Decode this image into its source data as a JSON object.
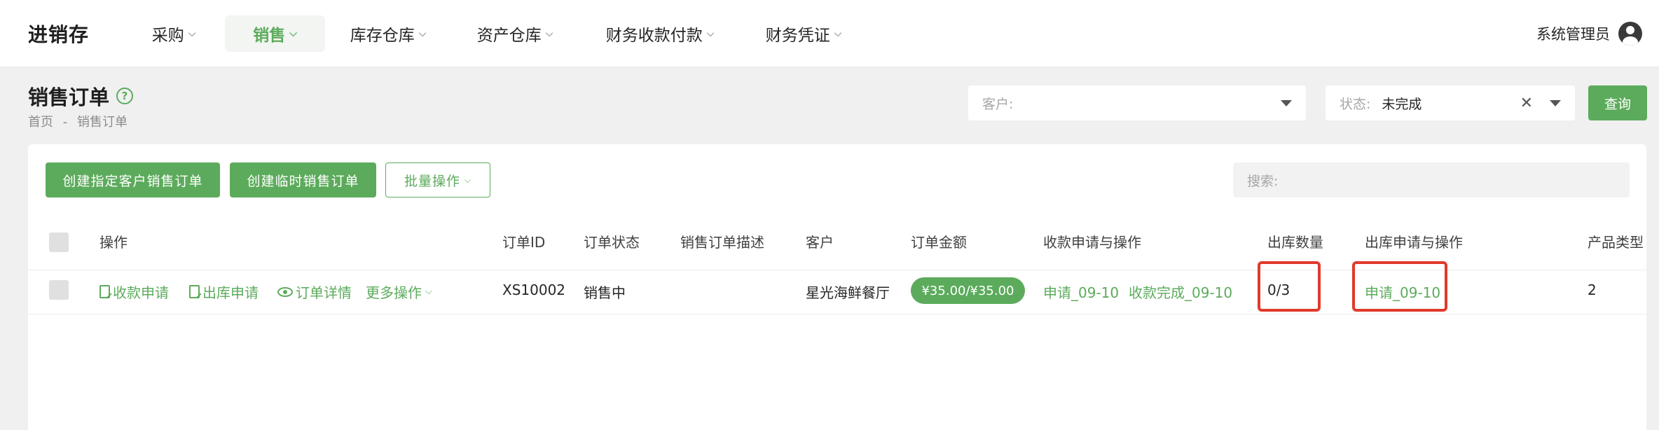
{
  "app": {
    "title": "进销存"
  },
  "nav": [
    {
      "label": "采购",
      "active": false
    },
    {
      "label": "销售",
      "active": true
    },
    {
      "label": "库存仓库",
      "active": false
    },
    {
      "label": "资产仓库",
      "active": false
    },
    {
      "label": "财务收款付款",
      "active": false
    },
    {
      "label": "财务凭证",
      "active": false
    }
  ],
  "user": {
    "name": "系统管理员",
    "icon": "user-avatar-icon"
  },
  "page": {
    "title": "销售订单",
    "help_icon": "?",
    "breadcrumb": [
      "首页",
      "-",
      "销售订单"
    ]
  },
  "filters": {
    "customer": {
      "label": "客户:",
      "value": ""
    },
    "status": {
      "label": "状态:",
      "value": "未完成",
      "clear": "✕"
    },
    "query_label": "查询"
  },
  "toolbar": {
    "create_customer_order": "创建指定客户销售订单",
    "create_temp_order": "创建临时销售订单",
    "batch_ops": "批量操作",
    "search_placeholder": "搜索:"
  },
  "table": {
    "headers": {
      "ops": "操作",
      "order_id": "订单ID",
      "order_status": "订单状态",
      "description": "销售订单描述",
      "customer": "客户",
      "amount": "订单金额",
      "payment": "收款申请与操作",
      "out_qty": "出库数量",
      "out_apply": "出库申请与操作",
      "product_type": "产品类型"
    },
    "rows": [
      {
        "ops": {
          "payment_apply": "收款申请",
          "out_apply": "出库申请",
          "details": "订单详情",
          "more": "更多操作"
        },
        "order_id": "XS10002",
        "order_status": "销售中",
        "description": "",
        "customer": "星光海鲜餐厅",
        "amount": "¥35.00/¥35.00",
        "payment_apply_link": "申请_09-10",
        "payment_done_link": "收款完成_09-10",
        "out_qty": "0/3",
        "out_apply_link": "申请_09-10",
        "product_type": "2"
      }
    ]
  },
  "colors": {
    "accent": "#5cab5c",
    "highlight": "#e03a2c"
  }
}
